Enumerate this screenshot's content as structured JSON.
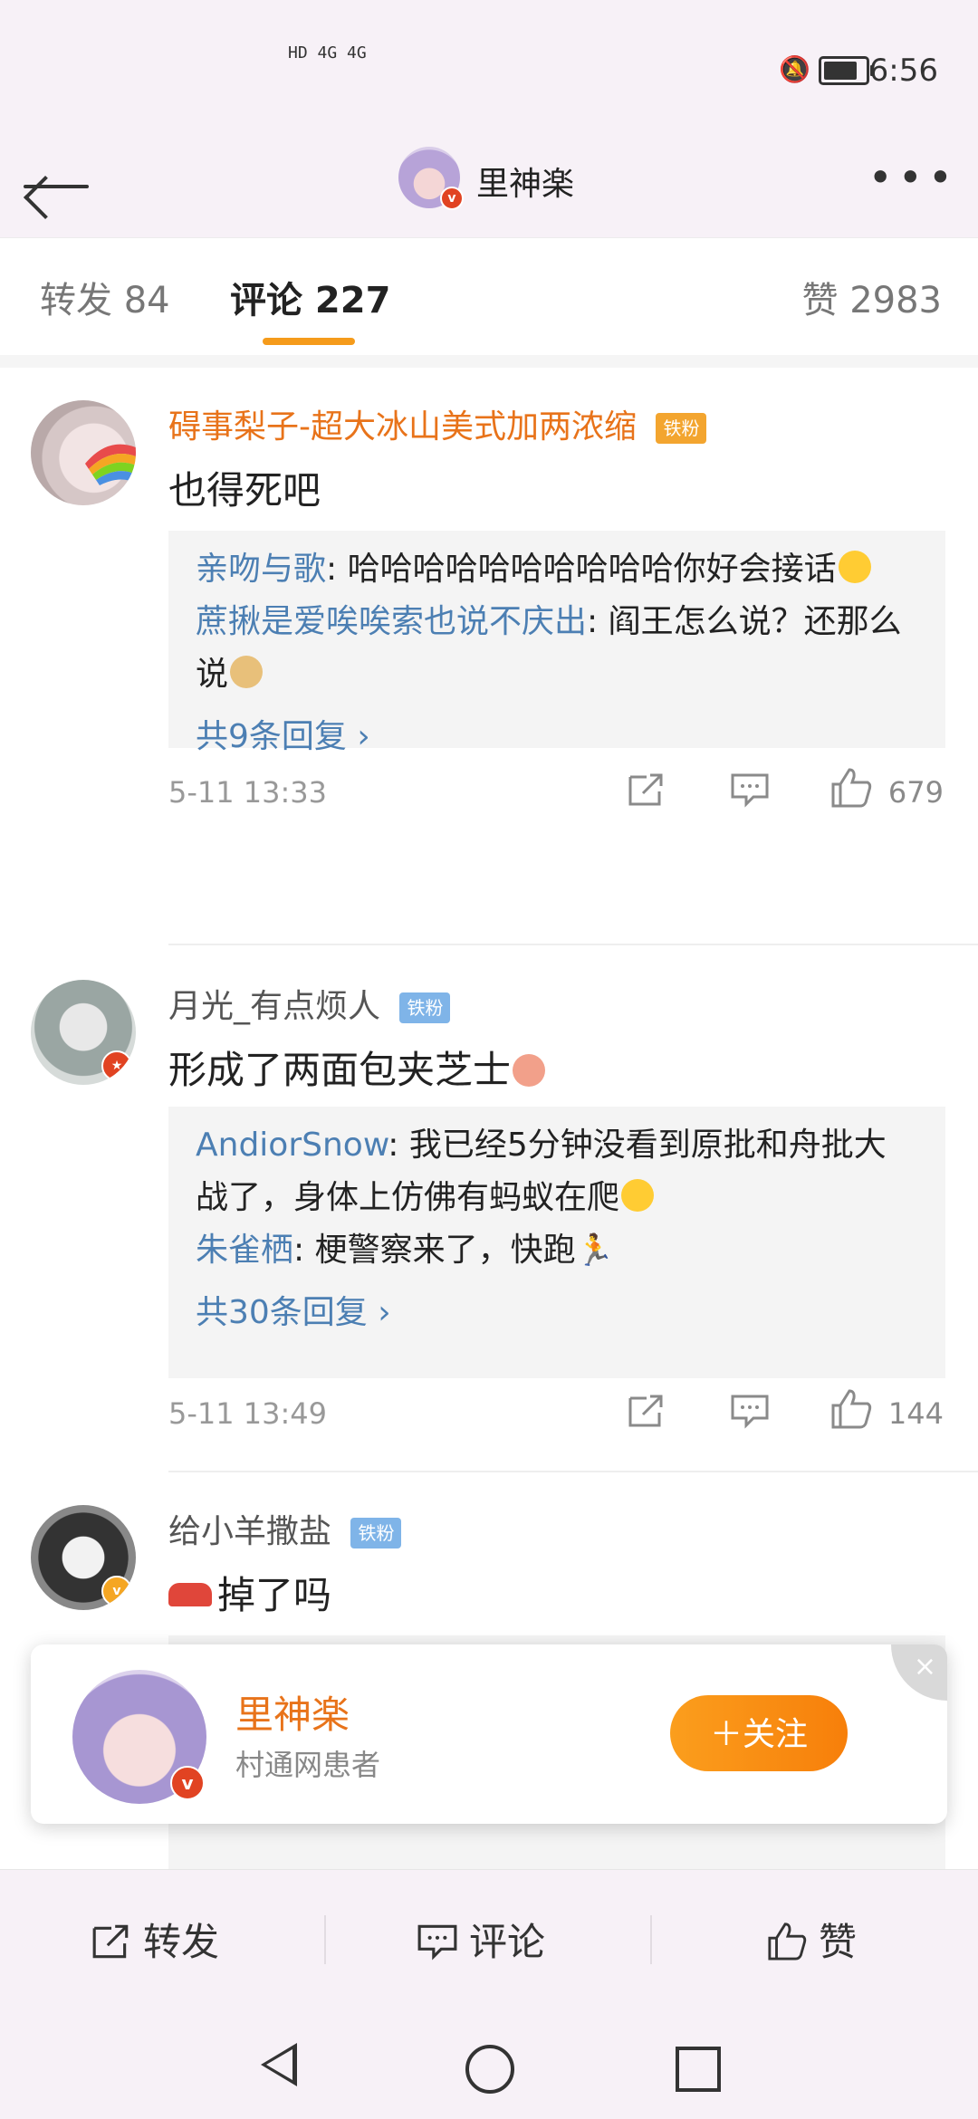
{
  "status_bar": {
    "signal_text": "HD 4G 4G",
    "time": "6:56"
  },
  "header": {
    "title": "里神楽",
    "more_label": "•••"
  },
  "tabs": {
    "repost": "转发 84",
    "comments": "评论 227",
    "likes": "赞 2983"
  },
  "comments": [
    {
      "username": "碍事梨子-超大冰山美式加两浓缩",
      "badge": "铁粉",
      "text": "也得死吧",
      "replies": [
        {
          "name": "亲吻与歌",
          "text": ": 哈哈哈哈哈哈哈哈哈哈你好会接话"
        },
        {
          "name": "蔗揪是爱唉唉索也说不庆出",
          "text": ": 阎王怎么说？还那么说"
        }
      ],
      "reply_count": "共9条回复 ›",
      "time": "5-11 13:33",
      "likes": "679"
    },
    {
      "username": "月光_有点烦人",
      "badge": "铁粉",
      "text": "形成了两面包夹芝士",
      "replies": [
        {
          "name": "AndiorSnow",
          "text": ": 我已经5分钟没看到原批和舟批大战了，身体上仿佛有蚂蚁在爬"
        },
        {
          "name": "朱雀栖",
          "text": ": 梗警察来了，快跑"
        }
      ],
      "reply_count": "共30条回复 ›",
      "time": "5-11 13:49",
      "likes": "144"
    },
    {
      "username": "给小羊撒盐",
      "badge": "铁粉",
      "text": "掉了吗"
    }
  ],
  "follow_card": {
    "name": "里神楽",
    "description": "村通网患者",
    "button": "＋关注",
    "close": "×"
  },
  "action_bar": {
    "repost": "转发",
    "comment": "评论",
    "like": "赞"
  },
  "colors": {
    "accent_orange": "#f59b1b",
    "link_blue": "#4c7fb3",
    "username_orange": "#e8731a"
  }
}
